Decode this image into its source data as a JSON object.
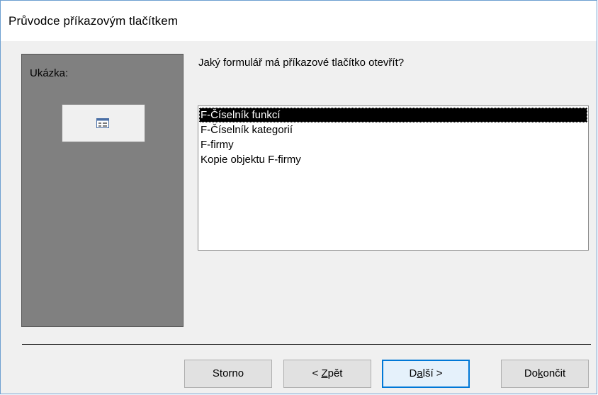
{
  "dialog": {
    "title": "Průvodce příkazovým tlačítkem"
  },
  "preview": {
    "label": "Ukázka:",
    "icon": "form-icon"
  },
  "question": "Jaký formulář má příkazové tlačítko otevřít?",
  "forms_list": {
    "selected_index": 0,
    "items": [
      "F-Číselník funkcí",
      "F-Číselník kategorií",
      "F-firmy",
      "Kopie objektu F-firmy"
    ]
  },
  "buttons": {
    "cancel": {
      "label": "Storno"
    },
    "back": {
      "prefix": "< ",
      "mnemonic": "Z",
      "rest": "pět"
    },
    "next": {
      "before": "D",
      "mnemonic": "a",
      "rest": "lší >"
    },
    "finish": {
      "before": "Do",
      "mnemonic": "k",
      "rest": "ončit"
    }
  },
  "colors": {
    "accent": "#0078d7",
    "selection": "#000000",
    "preview_bg": "#808080"
  }
}
